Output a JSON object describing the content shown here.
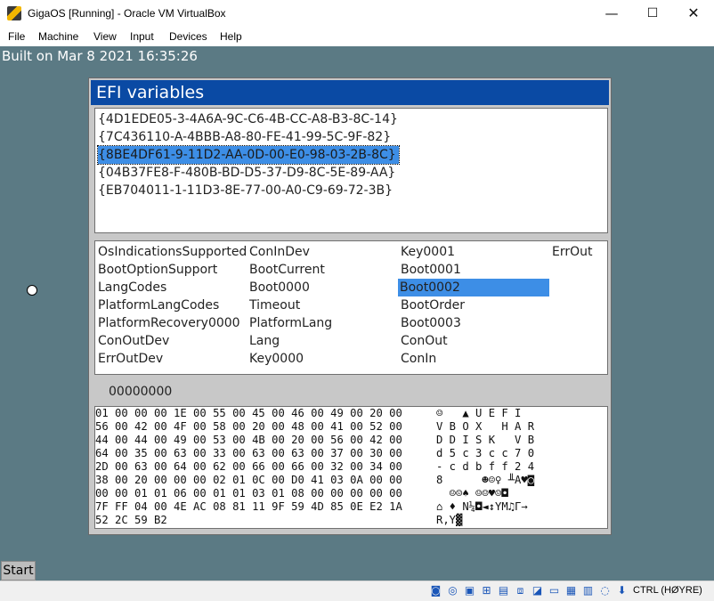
{
  "window": {
    "title": "GigaOS [Running] - Oracle VM VirtualBox",
    "controls": {
      "minimize": "—",
      "maximize": "☐",
      "close": "✕"
    }
  },
  "menu": [
    "File",
    "Machine",
    "View",
    "Input",
    "Devices",
    "Help"
  ],
  "guest": {
    "build_text": "Built on Mar  8 2021 16:35:26",
    "start_label": "Start",
    "efi": {
      "title": "EFI variables",
      "guids": [
        "{4D1EDE05-3-4A6A-9C-C6-4B-CC-A8-B3-8C-14}",
        "{7C436110-A-4BBB-A8-80-FE-41-99-5C-9F-82}",
        "{8BE4DF61-9-11D2-AA-0D-00-E0-98-03-2B-8C}",
        "{04B37FE8-F-480B-BD-D5-37-D9-8C-5E-89-AA}",
        "{EB704011-1-11D3-8E-77-00-A0-C9-69-72-3B}"
      ],
      "variables": {
        "col1": [
          "OsIndicationsSupported",
          "BootOptionSupport",
          "LangCodes",
          "PlatformLangCodes",
          "PlatformRecovery0000",
          "ConOutDev",
          "ErrOutDev"
        ],
        "col2": [
          "ConInDev",
          "BootCurrent",
          "Boot0000",
          "Timeout",
          "PlatformLang",
          "Lang",
          "Key0000"
        ],
        "col3": [
          "Key0001",
          "Boot0001",
          "Boot0002",
          "BootOrder",
          "Boot0003",
          "ConOut",
          "ConIn"
        ],
        "col4": [
          "ErrOut"
        ]
      },
      "attributes": "00000000",
      "hex_rows": [
        "01 00 00 00 1E 00 55 00 45 00 46 00 49 00 20 00",
        "56 00 42 00 4F 00 58 00 20 00 48 00 41 00 52 00",
        "44 00 44 00 49 00 53 00 4B 00 20 00 56 00 42 00",
        "64 00 35 00 63 00 33 00 63 00 63 00 37 00 30 00",
        "2D 00 63 00 64 00 62 00 66 00 66 00 32 00 34 00",
        "38 00 20 00 00 00 02 01 0C 00 D0 41 03 0A 00 00",
        "00 00 01 01 06 00 01 01 03 01 08 00 00 00 00 00",
        "7F FF 04 00 4E AC 08 81 11 9F 59 4D 85 0E E2 1A",
        "52 2C 59 B2"
      ],
      "ascii_rows": [
        "☺   ▲ U E F I  ",
        "V B O X   H A R",
        "D D I S K   V B",
        "d 5 c 3 c c 7 0",
        "- c d b f f 2 4",
        "8      ☻☺♀ ╨A♥◙",
        "  ☺☺♠ ☺☺♥☺◘",
        "⌂ ♦ N¼◘◄↕YM♫Γ→",
        "R,Y▓"
      ]
    }
  },
  "statusbar": {
    "icons": [
      "hdd-icon",
      "cd-icon",
      "audio-icon",
      "network-icon",
      "usb-icon",
      "shared-folder-icon",
      "display-icon",
      "video-capture-icon",
      "vrde-icon",
      "cpu-icon",
      "mouse-integration-icon",
      "keyboard-icon"
    ],
    "host_key": "CTRL (HØYRE)"
  }
}
